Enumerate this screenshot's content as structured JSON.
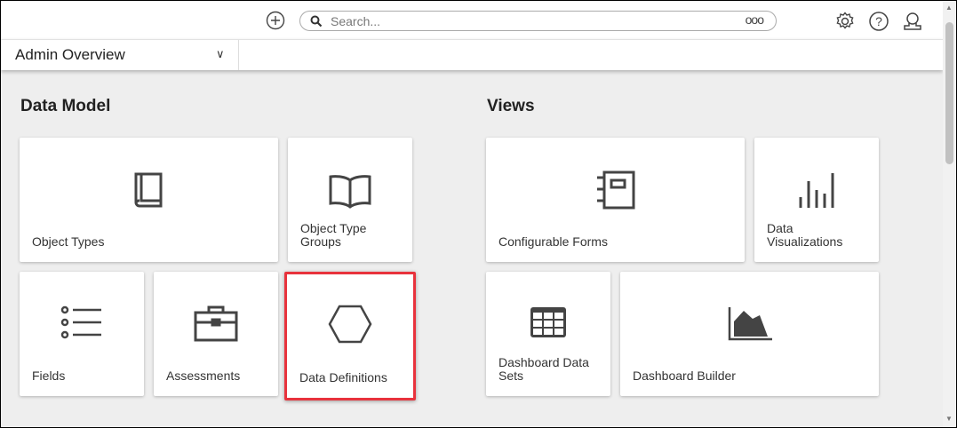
{
  "topbar": {
    "search_placeholder": "Search...",
    "more": "ooo",
    "icons": [
      "plus-circle-icon",
      "search-icon",
      "gear-icon",
      "help-icon",
      "user-icon"
    ]
  },
  "dashboard_select": {
    "value": "Admin Overview"
  },
  "sections": {
    "data_model": "Data Model",
    "views": "Views"
  },
  "cards": {
    "object_types": "Object Types",
    "object_type_groups": [
      "Object Type",
      "Groups"
    ],
    "fields": "Fields",
    "assessments": "Assessments",
    "data_definitions": "Data Definitions",
    "configurable_forms": "Configurable Forms",
    "data_visualizations": [
      "Data",
      "Visualizations"
    ],
    "dashboard_data_sets": [
      "Dashboard Data",
      "Sets"
    ],
    "dashboard_builder": "Dashboard Builder"
  },
  "colors": {
    "highlight": "#e8323c",
    "icon": "#444444",
    "background": "#eeeeee"
  }
}
